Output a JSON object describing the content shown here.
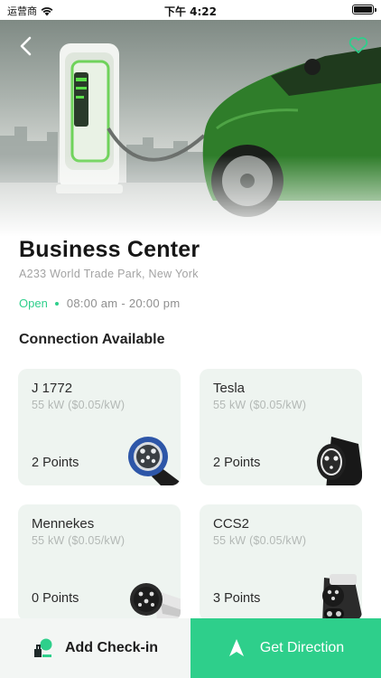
{
  "status_bar": {
    "carrier": "运营商",
    "time": "下午 4:22"
  },
  "station": {
    "name": "Business Center",
    "address": "A233 World Trade Park, New York",
    "status": "Open",
    "hours": "08:00 am - 20:00 pm"
  },
  "section_title": "Connection Available",
  "connectors": [
    {
      "name": "J 1772",
      "power": "55 kW ($0.05/kW)",
      "points": "2 Points",
      "icon": "j1772-plug-icon"
    },
    {
      "name": "Tesla",
      "power": "55 kW ($0.05/kW)",
      "points": "2 Points",
      "icon": "tesla-plug-icon"
    },
    {
      "name": "Mennekes",
      "power": "55 kW ($0.05/kW)",
      "points": "0 Points",
      "icon": "mennekes-plug-icon"
    },
    {
      "name": "CCS2",
      "power": "55 kW ($0.05/kW)",
      "points": "3 Points",
      "icon": "ccs2-plug-icon"
    }
  ],
  "actions": {
    "checkin_label": "Add Check-in",
    "direction_label": "Get Direction"
  },
  "colors": {
    "accent": "#2ecf8b",
    "card_bg": "#eef4f0",
    "car_green": "#2f7d2a"
  }
}
